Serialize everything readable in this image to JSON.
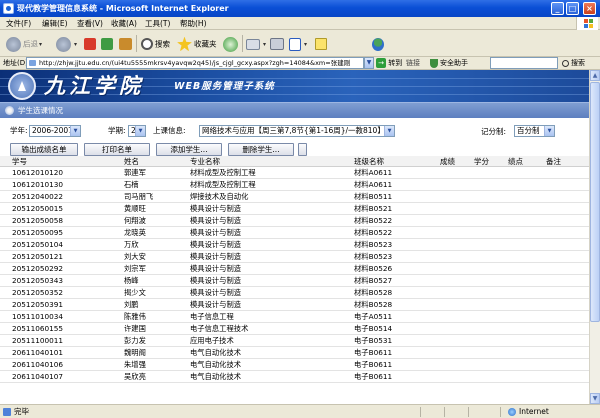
{
  "window": {
    "title": "现代教学管理信息系统 - Microsoft Internet Explorer",
    "controls": {
      "minimize": "_",
      "maximize": "□",
      "close": "×"
    }
  },
  "menu": [
    "文件(F)",
    "编辑(E)",
    "查看(V)",
    "收藏(A)",
    "工具(T)",
    "帮助(H)"
  ],
  "toolbar": {
    "back": "后退",
    "favorites": "收藏夹",
    "search": "搜索"
  },
  "addressbar": {
    "label": "地址(D)",
    "url": "http://zhjw.jjtu.edu.cn/(ui4tu5555mkrsv4yavqw2q45)/js_cjgl_gcxy.aspx?zgh=14084&xm=张建刚",
    "go": "转到",
    "links": "链接",
    "safety": "安全助手",
    "search": "搜索"
  },
  "banner": {
    "college_name": "九江学院",
    "subtitle": "WEB服务管理子系统"
  },
  "section": {
    "title": "学生选课情况"
  },
  "filters": {
    "year_label": "学年:",
    "year_value": "2006-2007",
    "term_label": "学期:",
    "term_value": "2",
    "course_label": "上课信息:",
    "course_value": "网络技术与应用【周三第7,8节{第1-16周}/一教810】",
    "grading_label": "记分制:",
    "grading_value": "百分制"
  },
  "actions": {
    "export": "输出成绩名单",
    "print": "打印名单",
    "add": "添加学生...",
    "remove": "删除学生...",
    "extra": ""
  },
  "table": {
    "headers": [
      "学号",
      "姓名",
      "专业名称",
      "班级名称",
      "成绩",
      "学分",
      "绩点",
      "备注"
    ],
    "rows": [
      [
        "10612010120",
        "郭連军",
        "材料成型及控制工程",
        "材料A0611"
      ],
      [
        "10612010130",
        "石楠",
        "材料成型及控制工程",
        "材料A0611"
      ],
      [
        "20512040022",
        "司马朋飞",
        "焊接技术及自动化",
        "材料B0511"
      ],
      [
        "20512050015",
        "黄顺旺",
        "模具设计与制造",
        "材料B0521"
      ],
      [
        "20512050058",
        "何翔波",
        "模具设计与制造",
        "材料B0522"
      ],
      [
        "20512050095",
        "龙晓英",
        "模具设计与制造",
        "材料B0522"
      ],
      [
        "20512050104",
        "万欣",
        "模具设计与制造",
        "材料B0523"
      ],
      [
        "20512050121",
        "刘大安",
        "模具设计与制造",
        "材料B0523"
      ],
      [
        "20512050292",
        "刘宗军",
        "模具设计与制造",
        "材料B0526"
      ],
      [
        "20512050343",
        "杨峰",
        "模具设计与制造",
        "材料B0527"
      ],
      [
        "20512050352",
        "揭少文",
        "模具设计与制造",
        "材料B0528"
      ],
      [
        "20512050391",
        "刘鹏",
        "模具设计与制造",
        "材料B0528"
      ],
      [
        "10511010034",
        "陈雅伟",
        "电子信息工程",
        "电子A0511"
      ],
      [
        "20511060155",
        "许建国",
        "电子信息工程技术",
        "电子B0514"
      ],
      [
        "20511100011",
        "彭力发",
        "应用电子技术",
        "电子B0531"
      ],
      [
        "20611040101",
        "魏明阁",
        "电气自动化技术",
        "电子B0611"
      ],
      [
        "20611040106",
        "朱增强",
        "电气自动化技术",
        "电子B0611"
      ],
      [
        "20611040107",
        "吴欣亮",
        "电气自动化技术",
        "电子B0611"
      ]
    ]
  },
  "status": {
    "text": "完毕",
    "zone": "Internet"
  }
}
